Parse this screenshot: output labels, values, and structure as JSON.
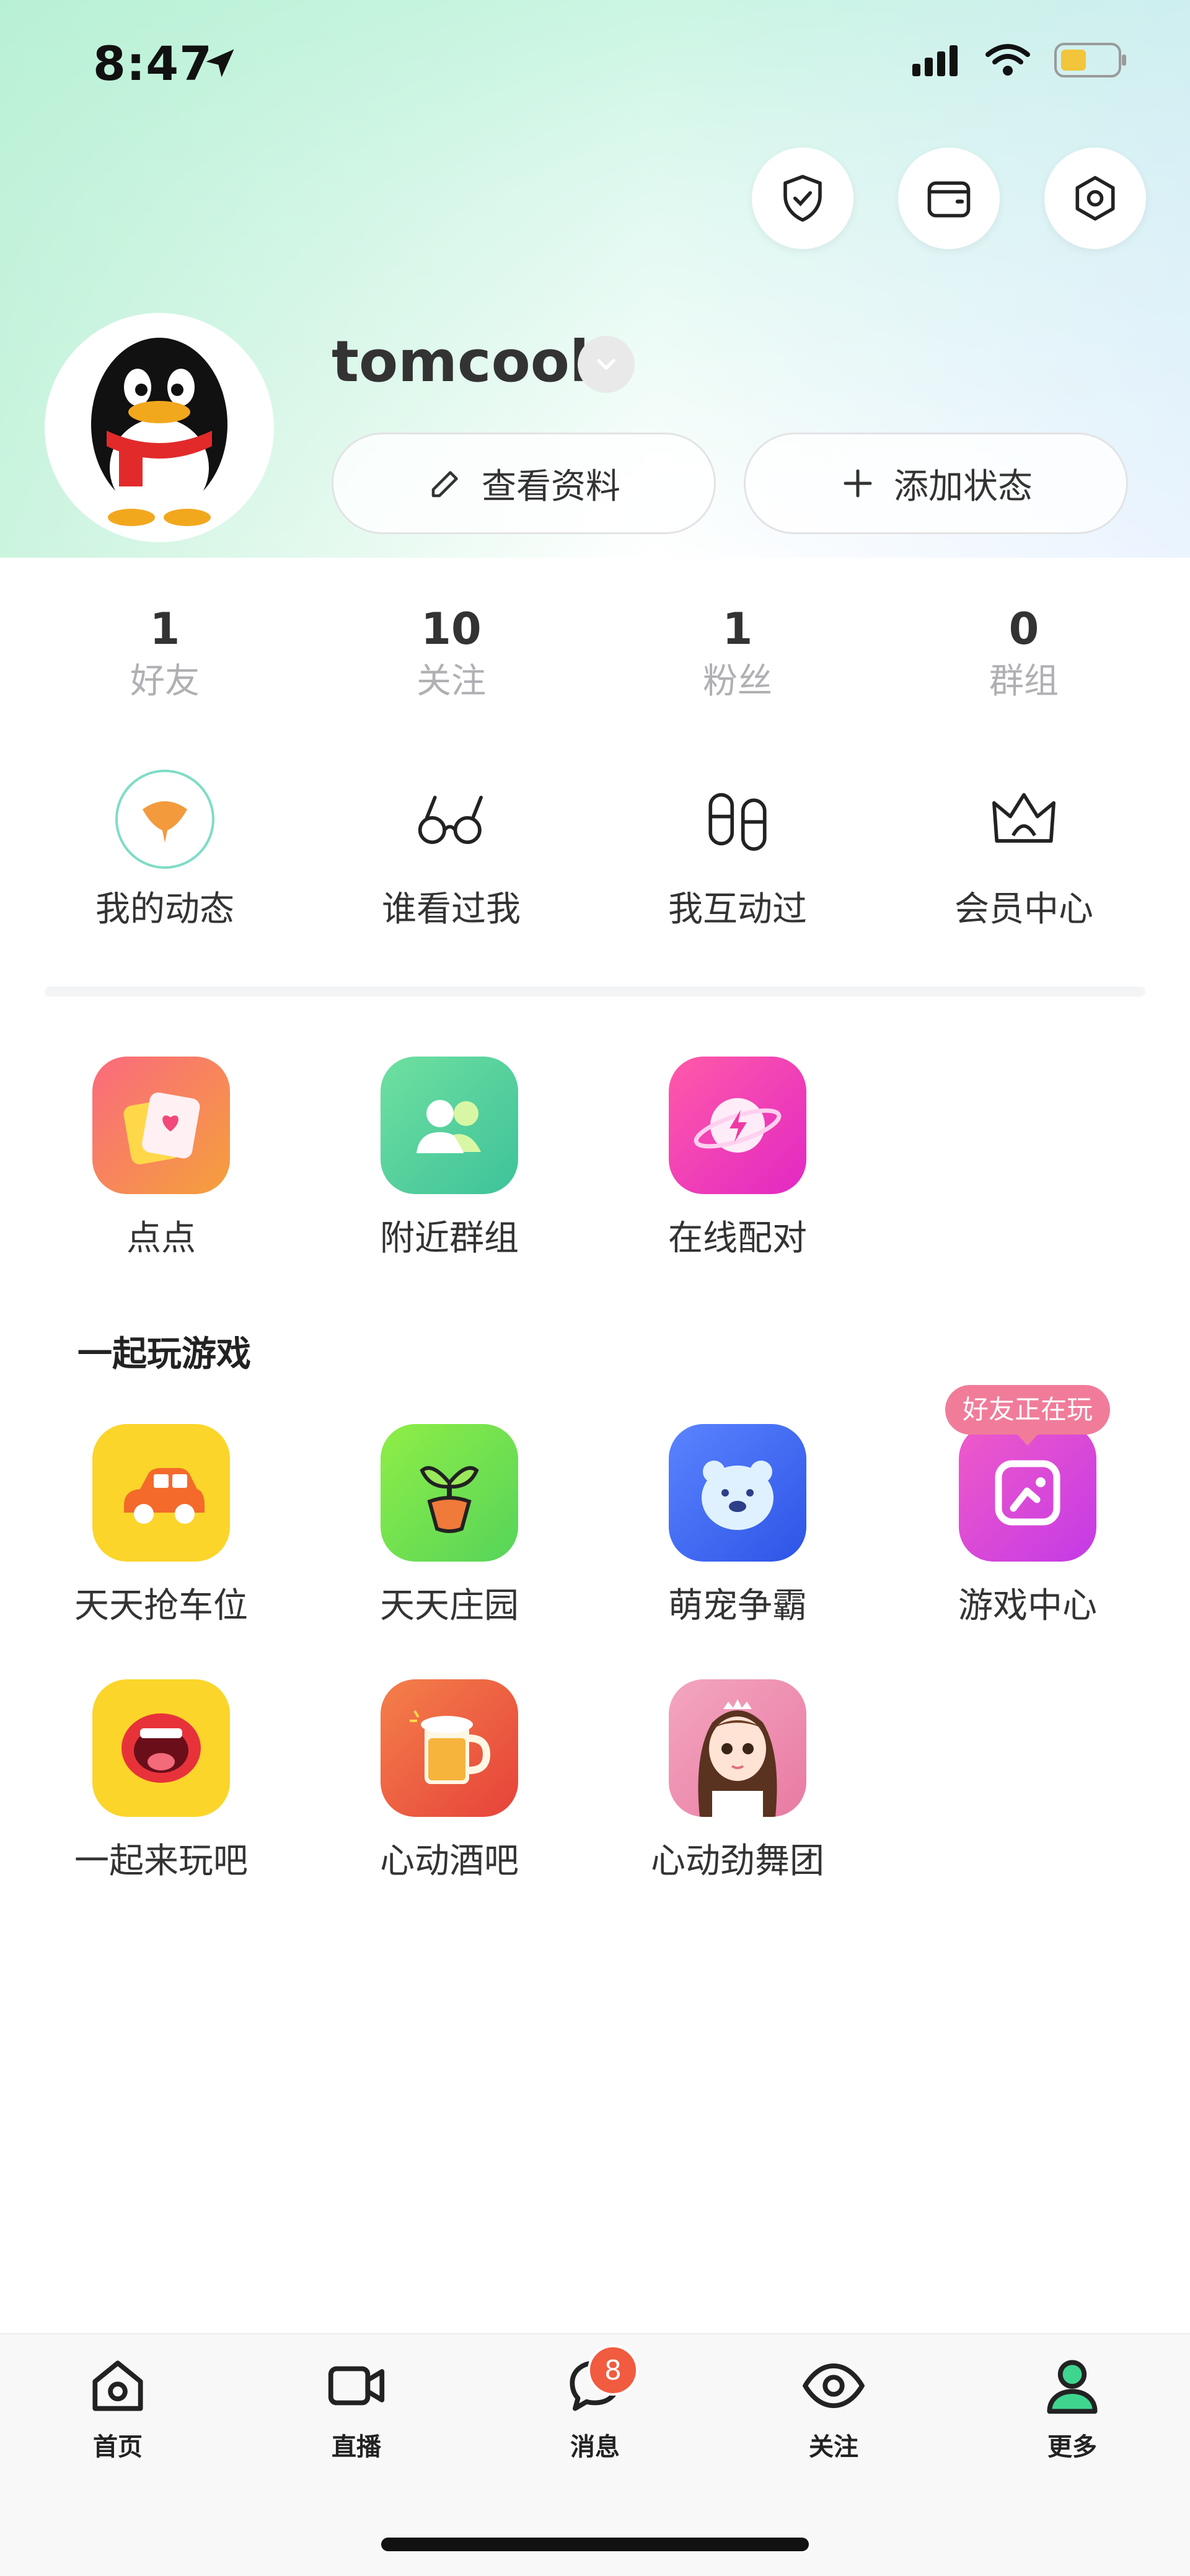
{
  "status_bar": {
    "time": "8:47"
  },
  "profile": {
    "username": "tomcook",
    "view_profile_label": "查看资料",
    "add_status_label": "添加状态"
  },
  "stats": [
    {
      "value": "1",
      "label": "好友"
    },
    {
      "value": "10",
      "label": "关注"
    },
    {
      "value": "1",
      "label": "粉丝"
    },
    {
      "value": "0",
      "label": "群组"
    }
  ],
  "quick_actions": [
    {
      "label": "我的动态",
      "icon": "ginkgo-leaf-icon"
    },
    {
      "label": "谁看过我",
      "icon": "glasses-icon"
    },
    {
      "label": "我互动过",
      "icon": "slippers-icon"
    },
    {
      "label": "会员中心",
      "icon": "crown-icon"
    }
  ],
  "apps": [
    {
      "label": "点点",
      "icon": "cards-heart-icon",
      "color": "#f5577a"
    },
    {
      "label": "附近群组",
      "icon": "people-group-icon",
      "color": "#4fd39a"
    },
    {
      "label": "在线配对",
      "icon": "planet-bolt-icon",
      "color": "#f23ec0"
    }
  ],
  "games": {
    "section_title": "一起玩游戏",
    "friends_playing_badge": "好友正在玩",
    "items": [
      {
        "label": "天天抢车位",
        "icon": "car-icon",
        "color": "#fbd52a"
      },
      {
        "label": "天天庄园",
        "icon": "sprout-icon",
        "color": "#7ee24a"
      },
      {
        "label": "萌宠争霸",
        "icon": "bear-icon",
        "color": "#3f6df0"
      },
      {
        "label": "游戏中心",
        "icon": "game-center-icon",
        "color": "#ec3fd6"
      },
      {
        "label": "一起来玩吧",
        "icon": "mouth-icon",
        "color": "#fbd52a"
      },
      {
        "label": "心动酒吧",
        "icon": "beer-mug-icon",
        "color": "#f26a38"
      },
      {
        "label": "心动劲舞团",
        "icon": "dancer-girl-icon",
        "color": "#ee8fb0"
      }
    ]
  },
  "tabbar": {
    "items": [
      {
        "label": "首页",
        "icon": "home-icon"
      },
      {
        "label": "直播",
        "icon": "video-camera-icon"
      },
      {
        "label": "消息",
        "icon": "chat-bubble-icon",
        "badge": "8"
      },
      {
        "label": "关注",
        "icon": "eye-icon"
      },
      {
        "label": "更多",
        "icon": "person-icon",
        "active": true
      }
    ]
  },
  "colors": {
    "accent": "#3fd58f",
    "badge": "#f15b3f",
    "bubble": "#f07c9a"
  }
}
